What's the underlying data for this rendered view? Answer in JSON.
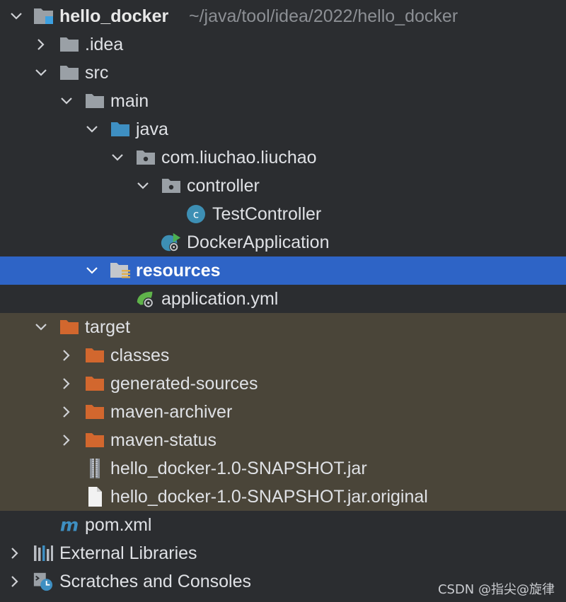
{
  "project": {
    "name": "hello_docker",
    "path": "~/java/tool/idea/2022/hello_docker"
  },
  "tree": {
    "idea": ".idea",
    "src": "src",
    "main": "main",
    "java": "java",
    "package": "com.liuchao.liuchao",
    "controller_pkg": "controller",
    "test_controller": "TestController",
    "docker_app": "DockerApplication",
    "resources": "resources",
    "application_yml": "application.yml",
    "target": "target",
    "classes": "classes",
    "generated_sources": "generated-sources",
    "maven_archiver": "maven-archiver",
    "maven_status": "maven-status",
    "jar": "hello_docker-1.0-SNAPSHOT.jar",
    "jar_original": "hello_docker-1.0-SNAPSHOT.jar.original",
    "pom": "pom.xml",
    "external_libraries": "External Libraries",
    "scratches": "Scratches and Consoles"
  },
  "watermark": "CSDN @指尖@旋律",
  "colors": {
    "background": "#2b2d30",
    "selection": "#2e64c6",
    "excluded_bg": "#4a4539",
    "folder_gray": "#9aa0a6",
    "folder_blue": "#3e8fc2",
    "folder_orange": "#d2672e",
    "class_icon": "#3d8fb4"
  },
  "icons": {
    "collapsed": "chevron-right-icon",
    "expanded": "chevron-down-icon",
    "folder": "folder-icon",
    "package": "package-icon",
    "class": "class-icon",
    "spring": "spring-icon",
    "archive": "jar-icon",
    "file": "file-icon",
    "maven": "maven-icon",
    "libraries": "libraries-icon",
    "scratches": "scratches-icon"
  }
}
